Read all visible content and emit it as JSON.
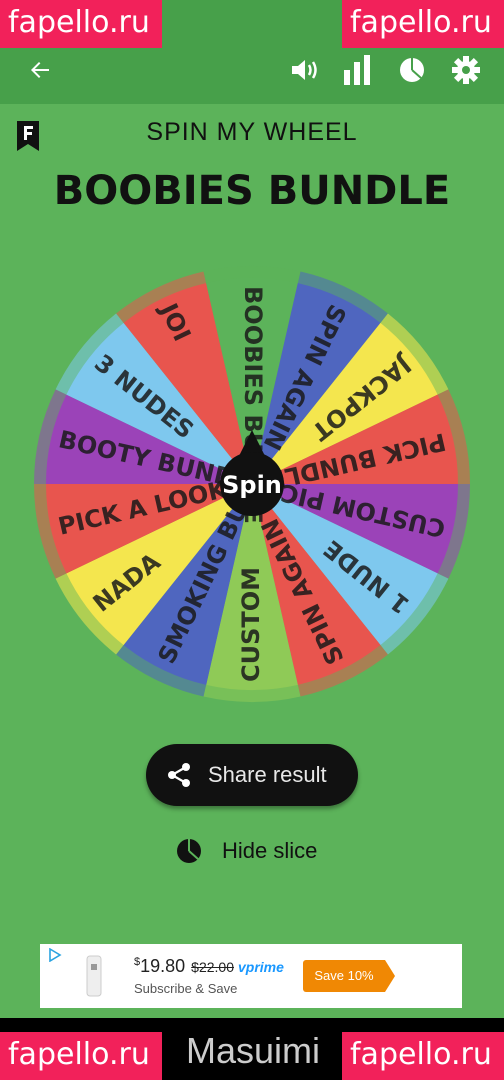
{
  "watermark": "fapello.ru",
  "header": {
    "back_icon": "arrow-left-icon",
    "volume_icon": "volume-icon",
    "stats_icon": "bar-chart-icon",
    "pie_icon": "pie-chart-icon",
    "settings_icon": "gear-icon"
  },
  "subtitle": "SPIN MY WHEEL",
  "title": "BOOBIES BUNDLE",
  "wheel": {
    "center_label": "Spin",
    "slices": [
      {
        "label": "JOI",
        "color": "#e8554e"
      },
      {
        "label": "BOOBIES BUNDLE",
        "color": "#5cb35a"
      },
      {
        "label": "SPIN AGAIN",
        "color": "#4f66bf"
      },
      {
        "label": "JACKPOT",
        "color": "#f4e64e"
      },
      {
        "label": "PICK BUNDLE",
        "color": "#e8554e"
      },
      {
        "label": "CUSTOM PIC",
        "color": "#9b43b8"
      },
      {
        "label": "1 NUDE",
        "color": "#7ec8ee"
      },
      {
        "label": "SPIN AGAIN",
        "color": "#e8554e"
      },
      {
        "label": "CUSTOM",
        "color": "#8fca57"
      },
      {
        "label": "SMOKING BUN",
        "color": "#4f66bf"
      },
      {
        "label": "NADA",
        "color": "#f4e64e"
      },
      {
        "label": "PICK A LOOK",
        "color": "#e8554e"
      },
      {
        "label": "BOOTY BUNDLE",
        "color": "#9b43b8"
      },
      {
        "label": "3 NUDES",
        "color": "#7ec8ee"
      }
    ]
  },
  "share_button": "Share result",
  "hide_slice": "Hide slice",
  "ad": {
    "price_currency": "$",
    "price": "19.80",
    "old_price": "$22.00",
    "prime": "vprime",
    "subtitle": "Subscribe & Save",
    "badge": "Save 10%"
  },
  "nav_text": "Masuimi"
}
